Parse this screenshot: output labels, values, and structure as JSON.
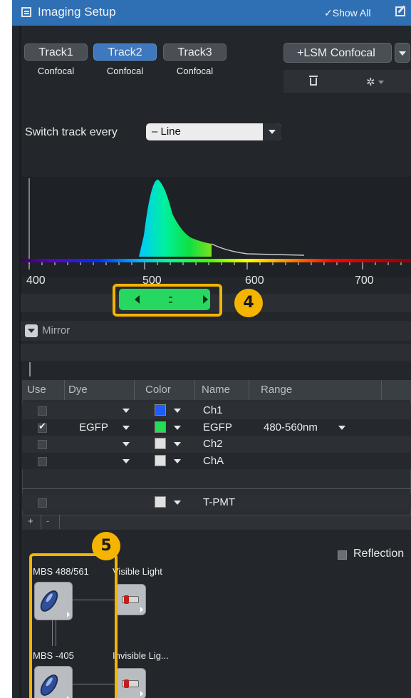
{
  "header": {
    "title": "Imaging Setup",
    "show_all": "Show All"
  },
  "tracks": [
    {
      "label": "Track1",
      "sub": "Confocal",
      "active": false
    },
    {
      "label": "Track2",
      "sub": "Confocal",
      "active": true
    },
    {
      "label": "Track3",
      "sub": "Confocal",
      "active": false
    }
  ],
  "add_config": {
    "label": "+LSM Confocal"
  },
  "switch": {
    "label": "Switch track every",
    "value": "– Line"
  },
  "spectrum": {
    "ticks": [
      "400",
      "500",
      "600",
      "700"
    ],
    "detection_range_nm": [
      480,
      560
    ]
  },
  "callouts": {
    "c4": "4",
    "c5": "5"
  },
  "mirror": {
    "label": "Mirror"
  },
  "channel_table": {
    "headers": [
      "Use",
      "Dye",
      "Color",
      "Name",
      "Range"
    ],
    "rows": [
      {
        "use": false,
        "dye": "",
        "color": "#1e5eff",
        "name": "Ch1",
        "range": ""
      },
      {
        "use": true,
        "dye": "EGFP",
        "color": "#22dd55",
        "name": "EGFP",
        "range": "480-560nm"
      },
      {
        "use": false,
        "dye": "",
        "color": "#e0e0e0",
        "name": "Ch2",
        "range": ""
      },
      {
        "use": false,
        "dye": "",
        "color": "#e0e0e0",
        "name": "ChA",
        "range": ""
      },
      {
        "use": false,
        "dye": "",
        "color": "#e0e0e0",
        "name": "T-PMT",
        "range": ""
      }
    ],
    "add": "+",
    "remove": "-"
  },
  "reflection": {
    "label": "Reflection",
    "checked": false
  },
  "components": [
    {
      "label": "MBS 488/561"
    },
    {
      "label": "Visible Light"
    },
    {
      "label": "MBS -405"
    },
    {
      "label": "Invisible Lig..."
    }
  ],
  "colors": {
    "accent": "#2f6fb4",
    "highlight": "#f5b400",
    "slider": "#26d760"
  }
}
